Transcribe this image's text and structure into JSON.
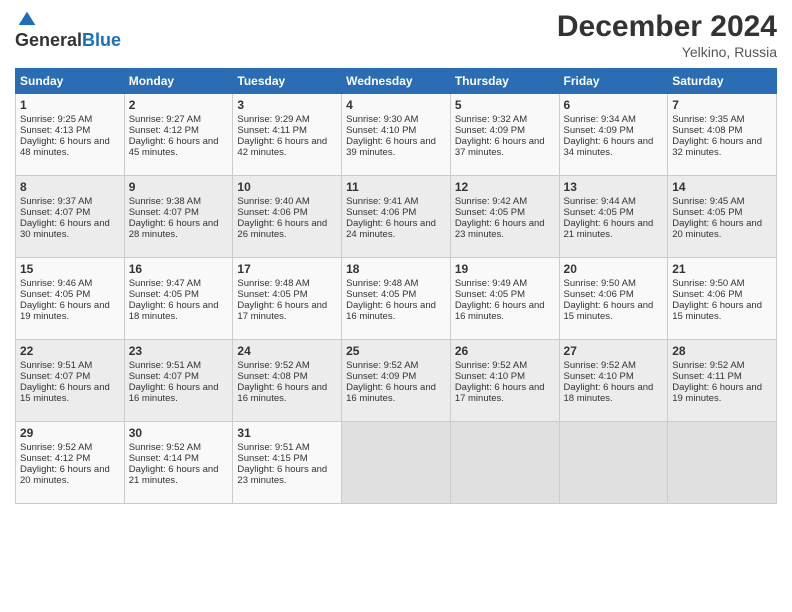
{
  "header": {
    "logo_general": "General",
    "logo_blue": "Blue",
    "month": "December 2024",
    "location": "Yelkino, Russia"
  },
  "weekdays": [
    "Sunday",
    "Monday",
    "Tuesday",
    "Wednesday",
    "Thursday",
    "Friday",
    "Saturday"
  ],
  "weeks": [
    [
      {
        "day": "1",
        "sunrise": "Sunrise: 9:25 AM",
        "sunset": "Sunset: 4:13 PM",
        "daylight": "Daylight: 6 hours and 48 minutes."
      },
      {
        "day": "2",
        "sunrise": "Sunrise: 9:27 AM",
        "sunset": "Sunset: 4:12 PM",
        "daylight": "Daylight: 6 hours and 45 minutes."
      },
      {
        "day": "3",
        "sunrise": "Sunrise: 9:29 AM",
        "sunset": "Sunset: 4:11 PM",
        "daylight": "Daylight: 6 hours and 42 minutes."
      },
      {
        "day": "4",
        "sunrise": "Sunrise: 9:30 AM",
        "sunset": "Sunset: 4:10 PM",
        "daylight": "Daylight: 6 hours and 39 minutes."
      },
      {
        "day": "5",
        "sunrise": "Sunrise: 9:32 AM",
        "sunset": "Sunset: 4:09 PM",
        "daylight": "Daylight: 6 hours and 37 minutes."
      },
      {
        "day": "6",
        "sunrise": "Sunrise: 9:34 AM",
        "sunset": "Sunset: 4:09 PM",
        "daylight": "Daylight: 6 hours and 34 minutes."
      },
      {
        "day": "7",
        "sunrise": "Sunrise: 9:35 AM",
        "sunset": "Sunset: 4:08 PM",
        "daylight": "Daylight: 6 hours and 32 minutes."
      }
    ],
    [
      {
        "day": "8",
        "sunrise": "Sunrise: 9:37 AM",
        "sunset": "Sunset: 4:07 PM",
        "daylight": "Daylight: 6 hours and 30 minutes."
      },
      {
        "day": "9",
        "sunrise": "Sunrise: 9:38 AM",
        "sunset": "Sunset: 4:07 PM",
        "daylight": "Daylight: 6 hours and 28 minutes."
      },
      {
        "day": "10",
        "sunrise": "Sunrise: 9:40 AM",
        "sunset": "Sunset: 4:06 PM",
        "daylight": "Daylight: 6 hours and 26 minutes."
      },
      {
        "day": "11",
        "sunrise": "Sunrise: 9:41 AM",
        "sunset": "Sunset: 4:06 PM",
        "daylight": "Daylight: 6 hours and 24 minutes."
      },
      {
        "day": "12",
        "sunrise": "Sunrise: 9:42 AM",
        "sunset": "Sunset: 4:05 PM",
        "daylight": "Daylight: 6 hours and 23 minutes."
      },
      {
        "day": "13",
        "sunrise": "Sunrise: 9:44 AM",
        "sunset": "Sunset: 4:05 PM",
        "daylight": "Daylight: 6 hours and 21 minutes."
      },
      {
        "day": "14",
        "sunrise": "Sunrise: 9:45 AM",
        "sunset": "Sunset: 4:05 PM",
        "daylight": "Daylight: 6 hours and 20 minutes."
      }
    ],
    [
      {
        "day": "15",
        "sunrise": "Sunrise: 9:46 AM",
        "sunset": "Sunset: 4:05 PM",
        "daylight": "Daylight: 6 hours and 19 minutes."
      },
      {
        "day": "16",
        "sunrise": "Sunrise: 9:47 AM",
        "sunset": "Sunset: 4:05 PM",
        "daylight": "Daylight: 6 hours and 18 minutes."
      },
      {
        "day": "17",
        "sunrise": "Sunrise: 9:48 AM",
        "sunset": "Sunset: 4:05 PM",
        "daylight": "Daylight: 6 hours and 17 minutes."
      },
      {
        "day": "18",
        "sunrise": "Sunrise: 9:48 AM",
        "sunset": "Sunset: 4:05 PM",
        "daylight": "Daylight: 6 hours and 16 minutes."
      },
      {
        "day": "19",
        "sunrise": "Sunrise: 9:49 AM",
        "sunset": "Sunset: 4:05 PM",
        "daylight": "Daylight: 6 hours and 16 minutes."
      },
      {
        "day": "20",
        "sunrise": "Sunrise: 9:50 AM",
        "sunset": "Sunset: 4:06 PM",
        "daylight": "Daylight: 6 hours and 15 minutes."
      },
      {
        "day": "21",
        "sunrise": "Sunrise: 9:50 AM",
        "sunset": "Sunset: 4:06 PM",
        "daylight": "Daylight: 6 hours and 15 minutes."
      }
    ],
    [
      {
        "day": "22",
        "sunrise": "Sunrise: 9:51 AM",
        "sunset": "Sunset: 4:07 PM",
        "daylight": "Daylight: 6 hours and 15 minutes."
      },
      {
        "day": "23",
        "sunrise": "Sunrise: 9:51 AM",
        "sunset": "Sunset: 4:07 PM",
        "daylight": "Daylight: 6 hours and 16 minutes."
      },
      {
        "day": "24",
        "sunrise": "Sunrise: 9:52 AM",
        "sunset": "Sunset: 4:08 PM",
        "daylight": "Daylight: 6 hours and 16 minutes."
      },
      {
        "day": "25",
        "sunrise": "Sunrise: 9:52 AM",
        "sunset": "Sunset: 4:09 PM",
        "daylight": "Daylight: 6 hours and 16 minutes."
      },
      {
        "day": "26",
        "sunrise": "Sunrise: 9:52 AM",
        "sunset": "Sunset: 4:10 PM",
        "daylight": "Daylight: 6 hours and 17 minutes."
      },
      {
        "day": "27",
        "sunrise": "Sunrise: 9:52 AM",
        "sunset": "Sunset: 4:10 PM",
        "daylight": "Daylight: 6 hours and 18 minutes."
      },
      {
        "day": "28",
        "sunrise": "Sunrise: 9:52 AM",
        "sunset": "Sunset: 4:11 PM",
        "daylight": "Daylight: 6 hours and 19 minutes."
      }
    ],
    [
      {
        "day": "29",
        "sunrise": "Sunrise: 9:52 AM",
        "sunset": "Sunset: 4:12 PM",
        "daylight": "Daylight: 6 hours and 20 minutes."
      },
      {
        "day": "30",
        "sunrise": "Sunrise: 9:52 AM",
        "sunset": "Sunset: 4:14 PM",
        "daylight": "Daylight: 6 hours and 21 minutes."
      },
      {
        "day": "31",
        "sunrise": "Sunrise: 9:51 AM",
        "sunset": "Sunset: 4:15 PM",
        "daylight": "Daylight: 6 hours and 23 minutes."
      },
      null,
      null,
      null,
      null
    ]
  ]
}
